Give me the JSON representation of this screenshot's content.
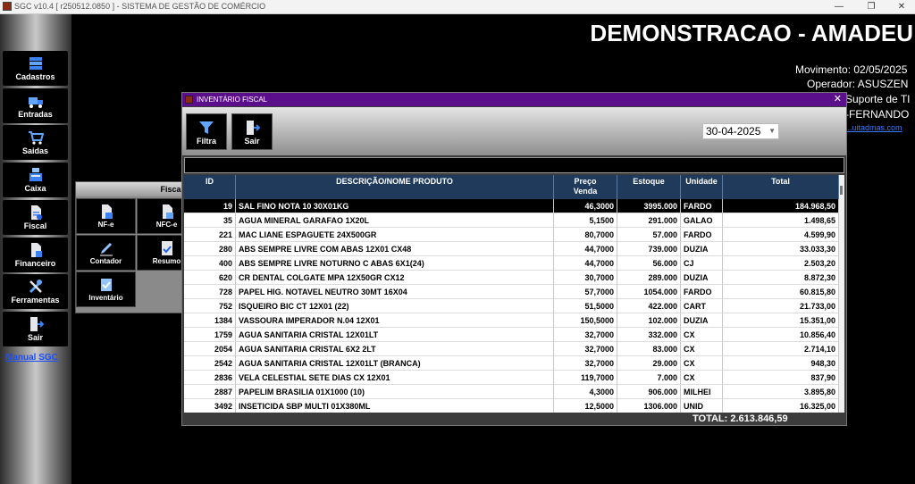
{
  "window": {
    "title": "SGC v10.4 [ r250512.0850 ] - SISTEMA DE GESTÃO DE COMÉRCIO",
    "minimize": "—",
    "maximize": "❐",
    "close": "✕"
  },
  "sidebar": {
    "items": [
      {
        "label": "Cadastros",
        "icon": "database-icon"
      },
      {
        "label": "Entradas",
        "icon": "truck-icon"
      },
      {
        "label": "Saidas",
        "icon": "cart-icon"
      },
      {
        "label": "Caixa",
        "icon": "cash-register-icon"
      },
      {
        "label": "Fiscal",
        "icon": "fiscal-document-icon"
      },
      {
        "label": "Financeiro",
        "icon": "finance-document-icon"
      },
      {
        "label": "Ferramentas",
        "icon": "tools-icon"
      },
      {
        "label": "Sair",
        "icon": "exit-door-icon"
      }
    ],
    "manual_link": "Manual SGC"
  },
  "header": {
    "company": "DEMONSTRACAO - AMADEU",
    "movimento": "Movimento: 02/05/2025",
    "operador": "Operador: ASUSZEN",
    "suporte": "Suporte de TI",
    "tecnico": "-FERNANDO",
    "link": "...uitadmas.com"
  },
  "fiscal_panel": {
    "title": "Fiscal",
    "buttons": [
      {
        "label": "NF-e",
        "icon": "nfe-document-icon"
      },
      {
        "label": "NFC-e",
        "icon": "nfce-document-icon"
      },
      {
        "label": "Contador",
        "icon": "accountant-pen-icon"
      },
      {
        "label": "Resumo",
        "icon": "summary-document-icon"
      },
      {
        "label": "Inventário",
        "icon": "inventory-check-icon"
      }
    ]
  },
  "dialog": {
    "title": "INVENTÁRIO FISCAL",
    "close": "✕",
    "toolbar": {
      "filter_label": "Filtra",
      "exit_label": "Sair"
    },
    "date_value": "30-04-2025",
    "columns": [
      "ID",
      "DESCRIÇÃO/NOME PRODUTO",
      "Preço\nVenda",
      "Estoque",
      "Unidade",
      "Total"
    ],
    "rows": [
      {
        "id": "19",
        "desc": "SAL FINO NOTA 10 30X01KG",
        "preco": "46,3000",
        "estoque": "3995.000",
        "unidade": "FARDO",
        "total": "184.968,50"
      },
      {
        "id": "35",
        "desc": "AGUA MINERAL GARAFAO 1X20L",
        "preco": "5,1500",
        "estoque": "291.000",
        "unidade": "GALAO",
        "total": "1.498,65"
      },
      {
        "id": "221",
        "desc": "MAC LIANE ESPAGUETE 24X500GR",
        "preco": "80,7000",
        "estoque": "57.000",
        "unidade": "FARDO",
        "total": "4.599,90"
      },
      {
        "id": "280",
        "desc": "ABS SEMPRE LIVRE COM ABAS 12X01  CX48",
        "preco": "44,7000",
        "estoque": "739.000",
        "unidade": "DUZIA",
        "total": "33.033,30"
      },
      {
        "id": "400",
        "desc": "ABS SEMPRE LIVRE NOTURNO C ABAS 6X1(24)",
        "preco": "44,7000",
        "estoque": "56.000",
        "unidade": "CJ",
        "total": "2.503,20"
      },
      {
        "id": "620",
        "desc": "CR DENTAL COLGATE MPA 12X50GR CX12",
        "preco": "30,7000",
        "estoque": "289.000",
        "unidade": "DUZIA",
        "total": "8.872,30"
      },
      {
        "id": "728",
        "desc": "PAPEL HIG. NOTAVEL NEUTRO 30MT 16X04",
        "preco": "57,7000",
        "estoque": "1054.000",
        "unidade": "FARDO",
        "total": "60.815,80"
      },
      {
        "id": "752",
        "desc": "ISQUEIRO BIC CT 12X01 (22)",
        "preco": "51,5000",
        "estoque": "422.000",
        "unidade": "CART",
        "total": "21.733,00"
      },
      {
        "id": "1384",
        "desc": "VASSOURA IMPERADOR N.04 12X01",
        "preco": "150,5000",
        "estoque": "102.000",
        "unidade": "DUZIA",
        "total": "15.351,00"
      },
      {
        "id": "1759",
        "desc": "AGUA SANITARIA CRISTAL 12X01LT",
        "preco": "32,7000",
        "estoque": "332.000",
        "unidade": "CX",
        "total": "10.856,40"
      },
      {
        "id": "2054",
        "desc": "AGUA SANITARIA CRISTAL 6X2 2LT",
        "preco": "32,7000",
        "estoque": "83.000",
        "unidade": "CX",
        "total": "2.714,10"
      },
      {
        "id": "2542",
        "desc": "AGUA SANITARIA CRISTAL 12X01LT (BRANCA)",
        "preco": "32,7000",
        "estoque": "29.000",
        "unidade": "CX",
        "total": "948,30"
      },
      {
        "id": "2836",
        "desc": "VELA CELESTIAL SETE DIAS CX 12X01",
        "preco": "119,7000",
        "estoque": "7.000",
        "unidade": "CX",
        "total": "837,90"
      },
      {
        "id": "2887",
        "desc": "PAPELIM BRASILIA  01X1000  (10)",
        "preco": "4,3000",
        "estoque": "906.000",
        "unidade": "MILHEI",
        "total": "3.895,80"
      },
      {
        "id": "3492",
        "desc": "INSETICIDA SBP MULTI 01X380ML",
        "preco": "12,5000",
        "estoque": "1306.000",
        "unidade": "UNID",
        "total": "16.325,00"
      }
    ],
    "total": "TOTAL: 2.613.846,59"
  },
  "colors": {
    "dialog_title": "#5b0f8a",
    "table_header": "#1f3a5a",
    "link": "#1b4dff"
  }
}
